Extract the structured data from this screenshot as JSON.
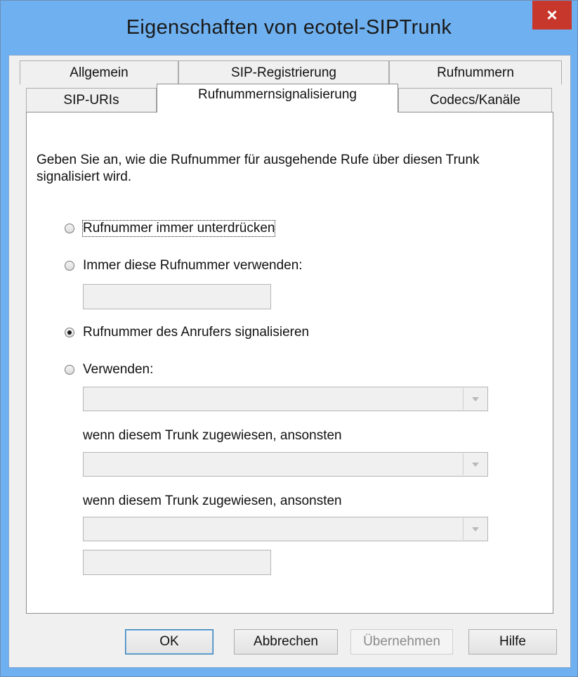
{
  "window": {
    "title": "Eigenschaften von ecotel-SIPTrunk",
    "close_label": "×"
  },
  "tabs_row1": [
    {
      "label": "Allgemein"
    },
    {
      "label": "SIP-Registrierung"
    },
    {
      "label": "Rufnummern"
    }
  ],
  "tabs_row2": [
    {
      "label": "SIP-URIs"
    },
    {
      "label": "Rufnummernsignalisierung",
      "active": true
    },
    {
      "label": "Codecs/Kanäle"
    }
  ],
  "panel": {
    "description": "Geben Sie an, wie die Rufnummer für ausgehende Rufe über diesen Trunk signalisiert wird.",
    "options": [
      {
        "label": "Rufnummer immer unterdrücken",
        "checked": false
      },
      {
        "label": "Immer diese Rufnummer verwenden:",
        "checked": false
      },
      {
        "label": "Rufnummer des Anrufers signalisieren",
        "checked": true
      },
      {
        "label": "Verwenden:",
        "checked": false
      }
    ],
    "fixed_number_value": "",
    "combo1_value": "",
    "fallback_label_1": "wenn diesem Trunk zugewiesen, ansonsten",
    "combo2_value": "",
    "fallback_label_2": "wenn diesem Trunk zugewiesen, ansonsten",
    "combo3_value": "",
    "final_number_value": ""
  },
  "buttons": {
    "ok": "OK",
    "cancel": "Abbrechen",
    "apply": "Übernehmen",
    "help": "Hilfe"
  }
}
